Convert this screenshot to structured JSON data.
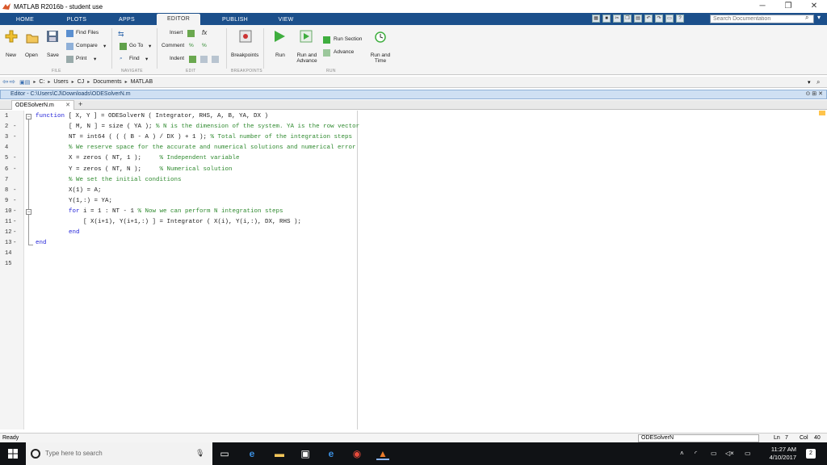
{
  "window": {
    "title": "MATLAB R2016b - student use"
  },
  "tabs": [
    {
      "label": "HOME"
    },
    {
      "label": "PLOTS"
    },
    {
      "label": "APPS"
    },
    {
      "label": "EDITOR"
    },
    {
      "label": "PUBLISH"
    },
    {
      "label": "VIEW"
    }
  ],
  "search": {
    "placeholder": "Search Documentation"
  },
  "ribbon": {
    "file": {
      "new": "New",
      "open": "Open",
      "save": "Save",
      "find_files": "Find Files",
      "compare": "Compare",
      "print": "Print",
      "section": "FILE"
    },
    "navigate": {
      "go_to": "Go To",
      "find": "Find",
      "section": "NAVIGATE"
    },
    "edit": {
      "insert": "Insert",
      "comment": "Comment",
      "indent": "Indent",
      "section": "EDIT",
      "fx": "fx"
    },
    "breakpoints": {
      "label": "Breakpoints",
      "section": "BREAKPOINTS"
    },
    "run": {
      "run": "Run",
      "run_advance": "Run and Advance",
      "run_section": "Run Section",
      "advance": "Advance",
      "run_time": "Run and Time",
      "section": "RUN"
    }
  },
  "address": {
    "crumbs": [
      "C:",
      "Users",
      "CJ",
      "Documents",
      "MATLAB"
    ]
  },
  "editor": {
    "title": "Editor - C:\\Users\\CJ\\Downloads\\ODESolverN.m",
    "tab": "ODESolverN.m",
    "lines": [
      {
        "n": "1",
        "dash": "",
        "parts": [
          {
            "t": "function ",
            "c": "kw"
          },
          {
            "t": "[ X, Y ] = ODESolverN ( Integrator, RHS, A, B, YA, DX )",
            "c": ""
          }
        ]
      },
      {
        "n": "2",
        "dash": "-",
        "parts": [
          {
            "t": "[ M, N ] = size ( YA ); ",
            "c": ""
          },
          {
            "t": "% N is the dimension of the system. YA is the row vector",
            "c": "cm"
          }
        ]
      },
      {
        "n": "3",
        "dash": "-",
        "parts": [
          {
            "t": "NT = int64 ( ( ( B - A ) / DX ) + 1 ); ",
            "c": ""
          },
          {
            "t": "% Total number of the integration steps",
            "c": "cm"
          }
        ]
      },
      {
        "n": "4",
        "dash": "",
        "parts": [
          {
            "t": "% We reserve space for the accurate and numerical solutions and numerical error",
            "c": "cm"
          }
        ]
      },
      {
        "n": "5",
        "dash": "-",
        "parts": [
          {
            "t": "X = zeros ( NT, 1 );     ",
            "c": ""
          },
          {
            "t": "% Independent variable",
            "c": "cm"
          }
        ]
      },
      {
        "n": "6",
        "dash": "-",
        "parts": [
          {
            "t": "Y = zeros ( NT, N );     ",
            "c": ""
          },
          {
            "t": "% Numerical solution",
            "c": "cm"
          }
        ]
      },
      {
        "n": "7",
        "dash": "",
        "parts": [
          {
            "t": "% We set the initial conditions",
            "c": "cm"
          }
        ]
      },
      {
        "n": "8",
        "dash": "-",
        "parts": [
          {
            "t": "X(1) = A;",
            "c": ""
          }
        ]
      },
      {
        "n": "9",
        "dash": "-",
        "parts": [
          {
            "t": "Y(1,:) = YA;",
            "c": ""
          }
        ]
      },
      {
        "n": "10",
        "dash": "-",
        "parts": [
          {
            "t": "for ",
            "c": "kw"
          },
          {
            "t": "i = 1 : NT - 1 ",
            "c": ""
          },
          {
            "t": "% Now we can perform N integration steps",
            "c": "cm"
          }
        ]
      },
      {
        "n": "11",
        "dash": "-",
        "parts": [
          {
            "t": "    [ X(i+1), Y(i+1,:) ] = Integrator ( X(i), Y(i,:), DX, RHS );",
            "c": ""
          }
        ]
      },
      {
        "n": "12",
        "dash": "-",
        "parts": [
          {
            "t": "end",
            "c": "kw"
          }
        ]
      },
      {
        "n": "13",
        "dash": "-",
        "parts": [
          {
            "t": "end",
            "c": "kw"
          }
        ]
      },
      {
        "n": "14",
        "dash": "",
        "parts": []
      },
      {
        "n": "15",
        "dash": "",
        "parts": []
      }
    ]
  },
  "status": {
    "ready": "Ready",
    "file": "ODESolverN",
    "ln_label": "Ln",
    "ln": "7",
    "col_label": "Col",
    "col": "40"
  },
  "taskbar": {
    "search_placeholder": "Type here to search",
    "time": "11:27 AM",
    "date": "4/10/2017",
    "notifications": "2"
  }
}
